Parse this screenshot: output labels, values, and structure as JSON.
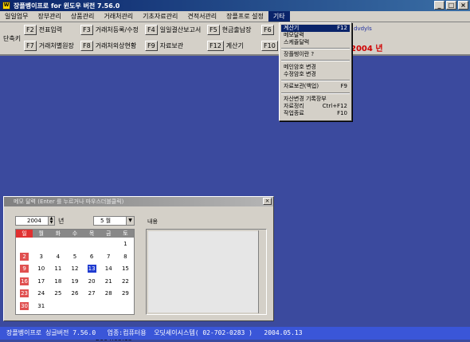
{
  "window": {
    "title": "장플벵이프로 for 윈도우 버전 7.56.0",
    "icon_label": "W",
    "min": "_",
    "max": "□",
    "close": "×"
  },
  "menu": [
    "일일업무",
    "장부관리",
    "상품관리",
    "거래처관리",
    "기초자료관리",
    "견적서관리",
    "장플프로 설정",
    "기타"
  ],
  "toolbar": {
    "shortcut_label": "단축키",
    "row1": [
      {
        "key": "F2",
        "label": "전표입력"
      },
      {
        "key": "F3",
        "label": "거래처등록/수정"
      },
      {
        "key": "F4",
        "label": "일일결산보고서"
      },
      {
        "key": "F5",
        "label": "현금출납장"
      },
      {
        "key": "F6",
        "label": ""
      }
    ],
    "row2": [
      {
        "key": "F7",
        "label": "거래처별원장"
      },
      {
        "key": "F8",
        "label": "거래처외상현황"
      },
      {
        "key": "F9",
        "label": "자료보관"
      },
      {
        "key": "F12",
        "label": "계산기"
      },
      {
        "key": "F10",
        "label": ""
      }
    ],
    "year_text": "2004 년",
    "right_text": "dvdyls"
  },
  "dropdown": [
    {
      "label": "계산기",
      "shortcut": "F12"
    },
    {
      "label": "메모달력",
      "shortcut": ""
    },
    {
      "label": "스케쥴달력",
      "shortcut": ""
    },
    {
      "label": "장플벵이란 ?",
      "shortcut": ""
    },
    {
      "label": "메인암호 변경",
      "shortcut": ""
    },
    {
      "label": "수정암호 변경",
      "shortcut": ""
    },
    {
      "label": "자료보관(백업)",
      "shortcut": "F9"
    },
    {
      "label": "자산변경 기록장부",
      "shortcut": ""
    },
    {
      "label": "자료정리",
      "shortcut": "Ctrl+F12"
    },
    {
      "label": "작업종료",
      "shortcut": "F10"
    }
  ],
  "memo": {
    "title": "메모 달력 (Enter 를 누르거나 마우스더블클릭)",
    "close": "×",
    "year": "2004",
    "year_unit": "년",
    "month": "5 월",
    "spin_up": "▲",
    "spin_down": "▼",
    "select_arrow": "▼",
    "note_label": "내용",
    "date_stamp": "2004.05.13",
    "dows": [
      "일",
      "월",
      "화",
      "수",
      "목",
      "금",
      "토"
    ],
    "weeks": [
      [
        "",
        "",
        "",
        "",
        "",
        "",
        "1"
      ],
      [
        "2",
        "3",
        "4",
        "5",
        "6",
        "7",
        "8"
      ],
      [
        "9",
        "10",
        "11",
        "12",
        "13",
        "14",
        "15"
      ],
      [
        "16",
        "17",
        "18",
        "19",
        "20",
        "21",
        "22"
      ],
      [
        "23",
        "24",
        "25",
        "26",
        "27",
        "28",
        "29"
      ],
      [
        "30",
        "31",
        "",
        "",
        "",
        "",
        ""
      ]
    ],
    "today": "13"
  },
  "status": "장플벵이프로 싱글버전 7.56.0   업종:컴퓨터용  오딧세이시스템( 02-702-0283 )   2004.05.13"
}
